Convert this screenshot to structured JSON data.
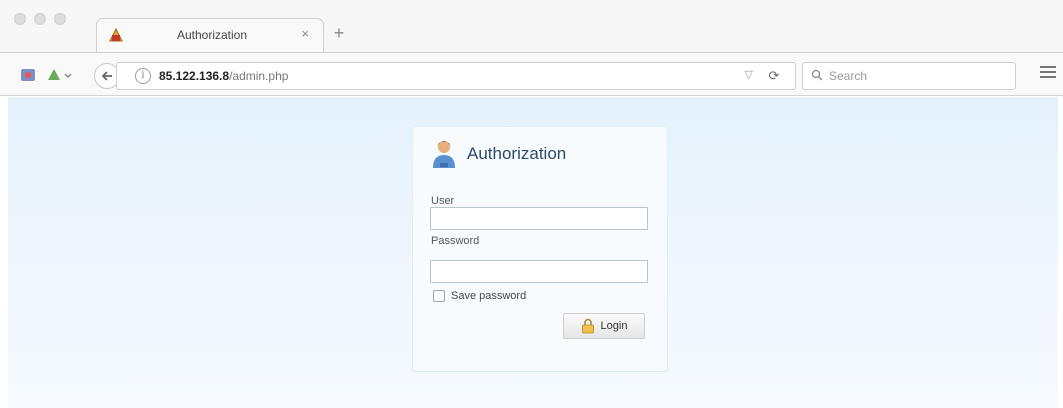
{
  "browser": {
    "tab_title": "Authorization",
    "tab_close": "×",
    "new_tab": "+",
    "url_host": "85.122.136.8",
    "url_path": "/admin.php",
    "search_placeholder": "Search"
  },
  "login": {
    "title": "Authorization",
    "user_label": "User",
    "user_value": "",
    "password_label": "Password",
    "password_value": "",
    "save_password_label": "Save password",
    "save_password_checked": false,
    "login_button": "Login"
  },
  "icons": {
    "tab": "site-favicon-icon",
    "back": "back-arrow-icon",
    "info": "site-info-icon",
    "search": "search-icon",
    "menu": "hamburger-menu-icon",
    "user": "user-icon",
    "lock": "lock-icon"
  },
  "colors": {
    "page_bg": "#e4f1fb",
    "panel_title": "#2f4a68"
  }
}
